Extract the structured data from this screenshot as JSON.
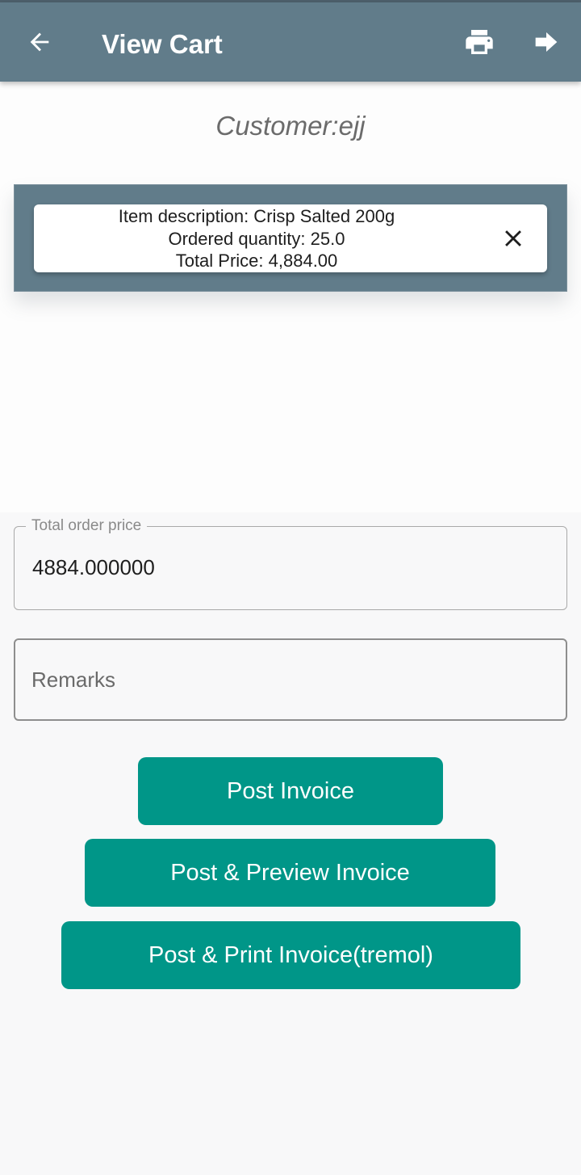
{
  "app_bar": {
    "title": "View Cart",
    "background_color": "#617c8a",
    "icons": [
      "arrow-back-icon",
      "print-icon",
      "arrow-forward-icon"
    ]
  },
  "customer": {
    "label": "Customer:ejj"
  },
  "cart_items": [
    {
      "description": "Item description: Crisp Salted 200g",
      "quantity": "Ordered quantity: 25.0",
      "total_price": "Total Price: 4,884.00"
    }
  ],
  "total_field": {
    "label": "Total order price",
    "value": "4884.000000"
  },
  "remarks_field": {
    "placeholder": "Remarks",
    "value": ""
  },
  "buttons": {
    "post_invoice": "Post Invoice",
    "post_preview": "Post & Preview Invoice",
    "post_print": "Post & Print Invoice(tremol)"
  },
  "colors": {
    "accent": "#009688",
    "panel": "#617c8a"
  }
}
